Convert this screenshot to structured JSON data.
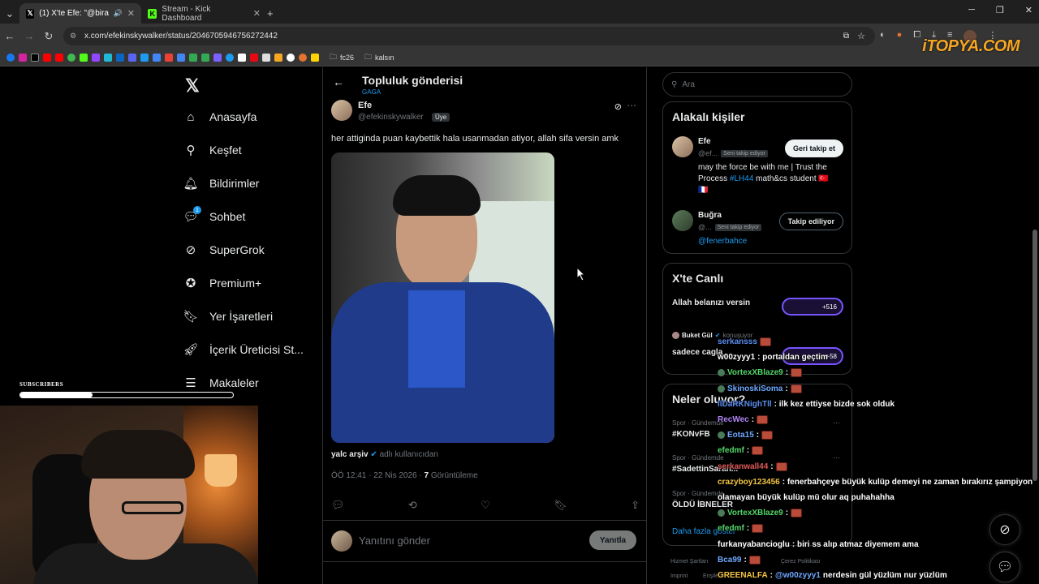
{
  "browser": {
    "tabs": [
      {
        "title": "(1) X'te Efe: \"@biradetbugr...",
        "active": true
      },
      {
        "title": "Stream - Kick Dashboard",
        "active": false
      }
    ],
    "url": "x.com/efekinskywalker/status/2046705946756272442",
    "bookmark_folders": [
      "fc26",
      "kalsın"
    ]
  },
  "watermark": "iTOPYA.COM",
  "sidebar": {
    "items": [
      {
        "label": "Anasayfa",
        "icon": "home-icon"
      },
      {
        "label": "Keşfet",
        "icon": "search-icon"
      },
      {
        "label": "Bildirimler",
        "icon": "bell-icon"
      },
      {
        "label": "Sohbet",
        "icon": "chat-icon",
        "badge": "1"
      },
      {
        "label": "SuperGrok",
        "icon": "grok-icon"
      },
      {
        "label": "Premium+",
        "icon": "verified-icon"
      },
      {
        "label": "Yer İşaretleri",
        "icon": "bookmark-icon"
      },
      {
        "label": "İçerik Üreticisi St...",
        "icon": "rocket-icon"
      },
      {
        "label": "Makaleler",
        "icon": "article-icon"
      }
    ]
  },
  "post": {
    "header_title": "Topluluk gönderisi",
    "header_sub": "GAGA",
    "author_name": "Efe",
    "author_handle": "@efekinskywalker",
    "member_badge": "Üye",
    "text": "her attiginda puan kaybettik hala usanmadan atiyor, allah sifa versin amk",
    "attribution_name": "yalc arşiv",
    "attribution_suffix": "adlı kullanıcıdan",
    "timestamp": "ÖÖ 12:41 · 22 Nis 2026 ·",
    "views_count": "7",
    "views_label": "Görüntüleme",
    "reply_placeholder": "Yanıtını gönder",
    "reply_button": "Yanıtla"
  },
  "right": {
    "search_placeholder": "Ara",
    "people_title": "Alakalı kişiler",
    "people": [
      {
        "name": "Efe",
        "handle": "@ef...",
        "follows_you": "Seni takip ediyor",
        "button": "Geri takip et",
        "bio_a": "may the force be with me | Trust the Process ",
        "bio_link": "#LH44",
        "bio_b": " math&cs student 🇹🇷",
        "bio_c": "🇫🇷"
      },
      {
        "name": "Buğra",
        "handle": "@...",
        "follows_you": "Seni takip ediyor",
        "button": "Takip ediliyor",
        "bio_link": "@fenerbahce"
      }
    ],
    "live_title": "X'te Canlı",
    "live": [
      {
        "title": "Allah belanızı versin",
        "count": "+516"
      },
      {
        "host": "Buket Gül",
        "status": "konuşuyor",
        "title": "sadece cagla",
        "count": "+58"
      }
    ],
    "trends_title": "Neler oluyor?",
    "trends": [
      {
        "category": "Spor · Gündemde",
        "name": "#KONvFB"
      },
      {
        "category": "Spor · Gündemde",
        "name": "#SadettinSaran..."
      },
      {
        "category": "Spor · Gündemde",
        "name": "ÖLDÜ İBNELER"
      }
    ],
    "show_more": "Daha fazla göster",
    "footer": [
      "Hizmet Şartları",
      "Çerez Politikası",
      "Imprint",
      "Erişilebilirlik"
    ]
  },
  "stream_overlay": {
    "subs_label": "SUBSCRIBERS",
    "subs_progress": 0.34,
    "chat": [
      {
        "user": "serkansss",
        "color": "#5b8def",
        "msg": "",
        "emote": true
      },
      {
        "user": "w00zyyy1",
        "color": "#ffffff",
        "msg": " : portaldan geçtim",
        "emote": false
      },
      {
        "user": "VortexXBlaze9",
        "color": "#53d769",
        "msg": " :",
        "emote": true,
        "sub": true
      },
      {
        "user": "SkinoskiSoma",
        "color": "#6fa8ff",
        "msg": " :",
        "emote": true,
        "sub": true
      },
      {
        "user": "llDaRKNighTll",
        "color": "#5b8def",
        "msg": " : ilk kez ettiyse bizde sok olduk",
        "emote": false
      },
      {
        "user": "RecWec",
        "color": "#b084f5",
        "msg": " :",
        "emote": true
      },
      {
        "user": "Eota15",
        "color": "#6fa8ff",
        "msg": " :",
        "emote": true,
        "sub": true
      },
      {
        "user": "efedmf",
        "color": "#53d769",
        "msg": " :",
        "emote": true
      },
      {
        "user": "serkanwall44",
        "color": "#e05a5a",
        "msg": " :",
        "emote": true
      },
      {
        "user": "crazyboy123456",
        "color": "#f5c542",
        "msg": " : fenerbahçeye büyük kulüp demeyi ne zaman bırakırız şampiyon",
        "emote": false
      },
      {
        "user": "",
        "color": "#ffffff",
        "msg": "olamayan büyük kulüp mü olur aq puhahahha",
        "emote": false
      },
      {
        "user": "VortexXBlaze9",
        "color": "#53d769",
        "msg": " :",
        "emote": true,
        "sub": true
      },
      {
        "user": "efedmf",
        "color": "#53d769",
        "msg": " :",
        "emote": true
      },
      {
        "user": "furkanyabancioglu",
        "color": "#ffffff",
        "msg": " : biri ss alıp atmaz diyemem ama",
        "emote": false
      },
      {
        "user": "Bca99",
        "color": "#6fa8ff",
        "msg": " :",
        "emote": true
      },
      {
        "user": "GREENALFA",
        "color": "#f5c542",
        "msg": " : ",
        "mention": "@w00zyyy1",
        "msg2": " nerdesin gül yüzlüm nur yüzlüm",
        "emote": false
      }
    ]
  },
  "colors": {
    "accent": "#1d9bf0",
    "bg": "#000000",
    "border": "#2f3336",
    "muted": "#71767b",
    "live": "#7856ff"
  }
}
